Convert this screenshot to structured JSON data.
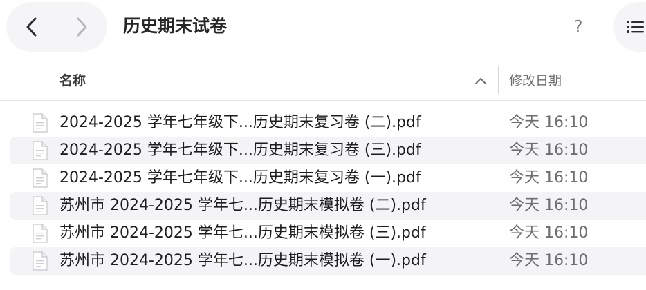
{
  "window": {
    "title": "历史期末试卷"
  },
  "toolbar": {
    "back_icon": "chevron-left-icon",
    "forward_icon": "chevron-right-icon",
    "help_label": "?",
    "view_icon": "list-view-icon"
  },
  "columns": {
    "name": "名称",
    "date_modified": "修改日期",
    "sort_icon": "chevron-up-icon"
  },
  "files": [
    {
      "name": "2024-2025 学年七年级下...历史期末复习卷 (二).pdf",
      "date": "今天 16:10"
    },
    {
      "name": "2024-2025 学年七年级下...历史期末复习卷 (三).pdf",
      "date": "今天 16:10"
    },
    {
      "name": "2024-2025 学年七年级下...历史期末复习卷 (一).pdf",
      "date": "今天 16:10"
    },
    {
      "name": "苏州市 2024-2025 学年七...历史期末模拟卷 (二).pdf",
      "date": "今天 16:10"
    },
    {
      "name": "苏州市 2024-2025 学年七...历史期末模拟卷 (三).pdf",
      "date": "今天 16:10"
    },
    {
      "name": "苏州市 2024-2025 学年七...历史期末模拟卷 (一).pdf",
      "date": "今天 16:10"
    }
  ],
  "colors": {
    "alt_row": "#f4f4f6",
    "pill_bg": "#f5f5f7",
    "text_primary": "#1d1d1f",
    "text_secondary": "#6e6e70"
  }
}
